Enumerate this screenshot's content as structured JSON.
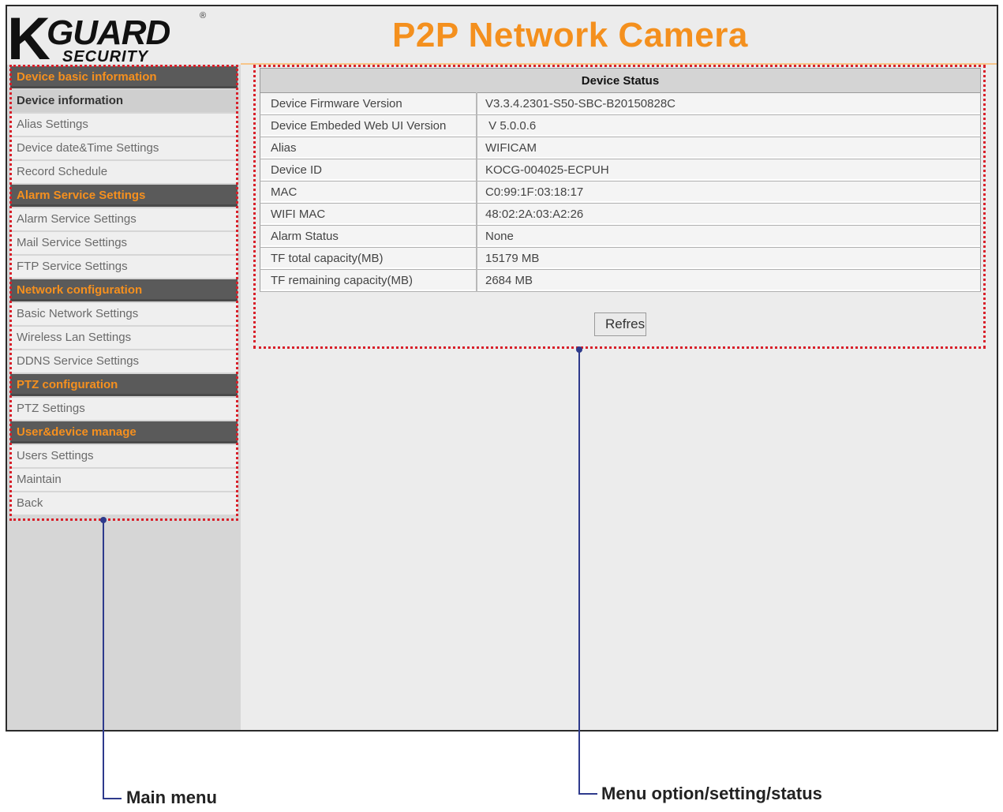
{
  "header": {
    "logo_k": "K",
    "logo_guard": "GUARD",
    "logo_security": "SECURITY",
    "logo_reg": "®",
    "title": "P2P Network Camera"
  },
  "menu": [
    {
      "type": "category",
      "label": "Device basic information"
    },
    {
      "type": "item",
      "label": "Device information",
      "active": true
    },
    {
      "type": "item",
      "label": "Alias Settings"
    },
    {
      "type": "item",
      "label": "Device date&Time Settings"
    },
    {
      "type": "item",
      "label": "Record Schedule"
    },
    {
      "type": "category",
      "label": "Alarm Service Settings"
    },
    {
      "type": "item",
      "label": "Alarm Service Settings"
    },
    {
      "type": "item",
      "label": "Mail Service Settings"
    },
    {
      "type": "item",
      "label": "FTP Service Settings"
    },
    {
      "type": "category",
      "label": "Network configuration"
    },
    {
      "type": "item",
      "label": "Basic Network Settings"
    },
    {
      "type": "item",
      "label": "Wireless Lan Settings"
    },
    {
      "type": "item",
      "label": "DDNS Service Settings"
    },
    {
      "type": "category",
      "label": "PTZ configuration"
    },
    {
      "type": "item",
      "label": "PTZ Settings"
    },
    {
      "type": "category",
      "label": "User&device manage"
    },
    {
      "type": "item",
      "label": "Users Settings"
    },
    {
      "type": "item",
      "label": "Maintain"
    },
    {
      "type": "item",
      "label": "Back"
    }
  ],
  "status": {
    "title": "Device Status",
    "rows": [
      {
        "label": "Device Firmware Version",
        "value": "V3.3.4.2301-S50-SBC-B20150828C"
      },
      {
        "label": "Device Embeded Web UI Version",
        "value": " V 5.0.0.6"
      },
      {
        "label": "Alias",
        "value": "WIFICAM"
      },
      {
        "label": "Device ID",
        "value": "KOCG-004025-ECPUH"
      },
      {
        "label": "MAC",
        "value": "C0:99:1F:03:18:17"
      },
      {
        "label": "WIFI MAC",
        "value": "48:02:2A:03:A2:26"
      },
      {
        "label": "Alarm Status",
        "value": "None"
      },
      {
        "label": "TF total capacity(MB)",
        "value": "15179 MB"
      },
      {
        "label": "TF remaining capacity(MB)",
        "value": "2684 MB"
      }
    ],
    "refresh_label": "Refresh"
  },
  "annotations": {
    "main_menu": "Main menu",
    "menu_option": "Menu option/setting/status"
  },
  "colors": {
    "title_orange": "#f4901e",
    "outline_red": "#d8202a",
    "annotation_blue": "#2e3a8c"
  }
}
